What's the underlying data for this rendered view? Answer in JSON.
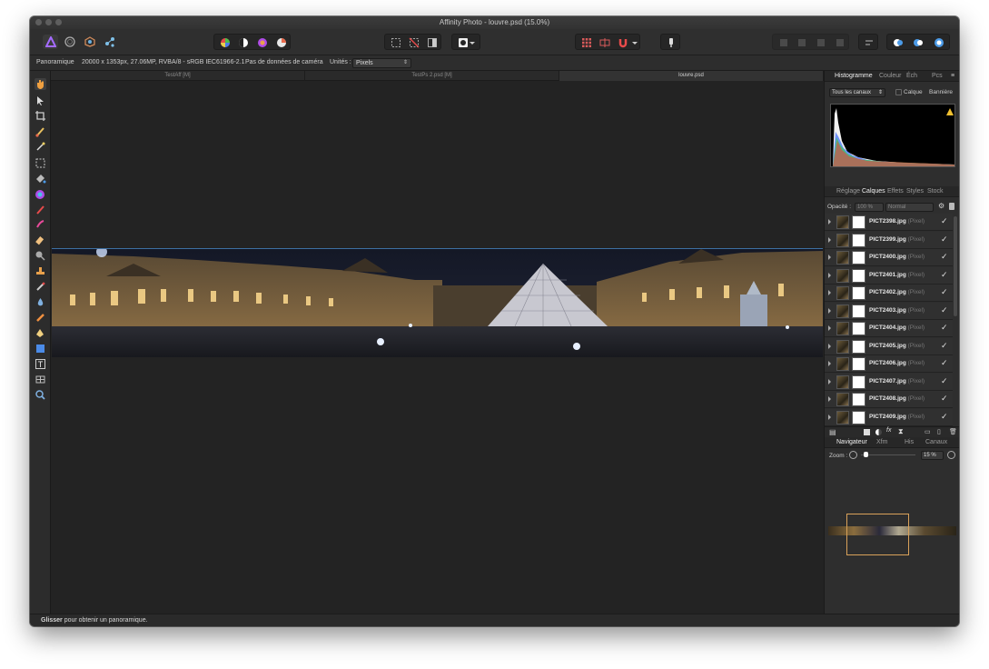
{
  "window": {
    "title": "Affinity Photo - louvre.psd (15.0%)"
  },
  "context_bar": {
    "persona": "Panoramique",
    "doc_info": "20000 x 1353px, 27.06MP, RVBA/8 - sRGB IEC61966-2.1",
    "camera": "Pas de données de caméra",
    "units_label": "Unités :",
    "units_value": "Pixels"
  },
  "doc_tabs": [
    "TestAff [M]",
    "TestPs 2.psd [M]",
    "louvre.psd"
  ],
  "panel": {
    "top_tabs": [
      "Histogramme",
      "Couleur",
      "Éch",
      "Pcs"
    ],
    "histogram": {
      "channels": "Tous les canaux",
      "layer": "Calque",
      "banner": "Bannière"
    },
    "mid_tabs": [
      "Réglage",
      "Calques",
      "Effets",
      "Styles",
      "Stock"
    ],
    "opacity_label": "Opacité :",
    "opacity_value": "100 %",
    "blend_mode": "Normal",
    "layers": [
      {
        "name": "PICT2398.jpg",
        "type": "(Pixel)"
      },
      {
        "name": "PICT2399.jpg",
        "type": "(Pixel)"
      },
      {
        "name": "PICT2400.jpg",
        "type": "(Pixel)"
      },
      {
        "name": "PICT2401.jpg",
        "type": "(Pixel)"
      },
      {
        "name": "PICT2402.jpg",
        "type": "(Pixel)"
      },
      {
        "name": "PICT2403.jpg",
        "type": "(Pixel)"
      },
      {
        "name": "PICT2404.jpg",
        "type": "(Pixel)"
      },
      {
        "name": "PICT2405.jpg",
        "type": "(Pixel)"
      },
      {
        "name": "PICT2406.jpg",
        "type": "(Pixel)"
      },
      {
        "name": "PICT2407.jpg",
        "type": "(Pixel)"
      },
      {
        "name": "PICT2408.jpg",
        "type": "(Pixel)"
      },
      {
        "name": "PICT2409.jpg",
        "type": "(Pixel)"
      }
    ],
    "bottom_tabs": [
      "Navigateur",
      "Xfm",
      "His",
      "Canaux"
    ],
    "zoom_label": "Zoom :",
    "zoom_value": "15 %"
  },
  "status": {
    "bold": "Glisser",
    "text": " pour obtenir un panoramique."
  },
  "colors": {
    "accent": "#7b4dff",
    "selection": "#3d6fa1",
    "nav_rect": "#d9a25a"
  }
}
